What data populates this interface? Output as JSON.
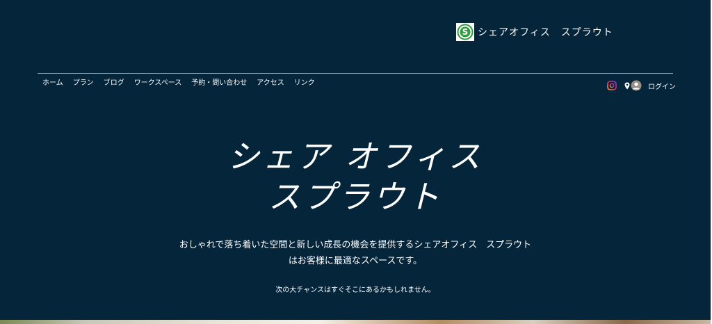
{
  "brand": {
    "name": "シェアオフィス　スプラウト",
    "logo_letter": "S",
    "logo_color": "#2e9b3f"
  },
  "nav": {
    "items": [
      {
        "label": "ホーム"
      },
      {
        "label": "プラン"
      },
      {
        "label": "ブログ"
      },
      {
        "label": "ワークスペース"
      },
      {
        "label": "予約・問い合わせ"
      },
      {
        "label": "アクセス"
      },
      {
        "label": "リンク"
      }
    ]
  },
  "tools": {
    "instagram_icon": "instagram-icon",
    "location_icon": "map-pin-icon",
    "avatar_icon": "user-avatar-icon",
    "login_label": "ログイン"
  },
  "hero": {
    "title_line1": "シェア オフィス",
    "title_line2": "スプラウト",
    "description_line1": "おしゃれで落ち着いた空間と新しい成長の機会を提供するシェアオフィス　スプラウト",
    "description_line2": "はお客様に最適なスペースです。",
    "subtext": "次の大チャンスはすぐそこにあるかもしれません。"
  },
  "colors": {
    "background": "#05253b",
    "text": "#ffffff",
    "divider": "#9aa7b2"
  }
}
